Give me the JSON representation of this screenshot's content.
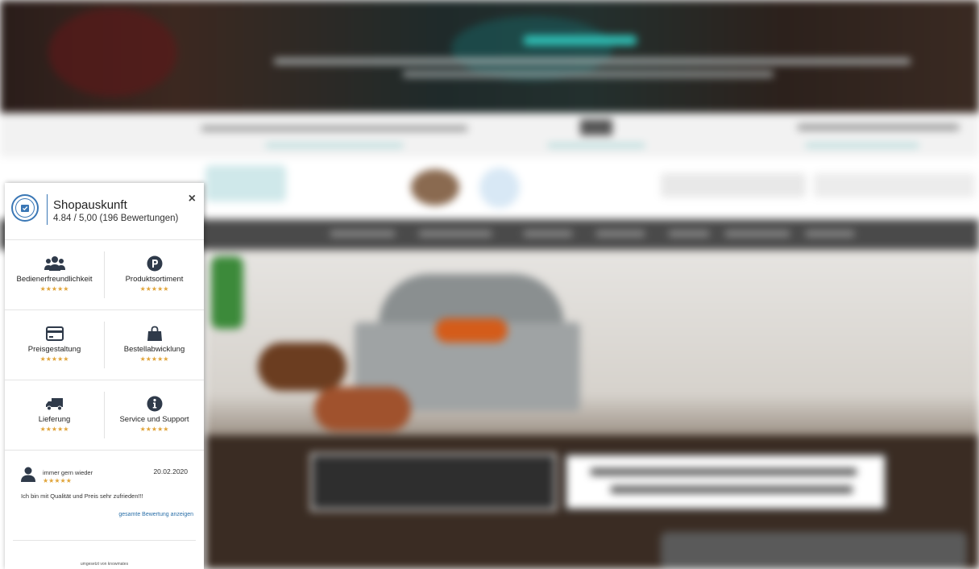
{
  "widget": {
    "title": "Shopauskunft",
    "rating": "4.84 / 5,00 (196 Bewertungen)",
    "close_icon": "×",
    "categories": [
      {
        "label": "Bedienerfreundlichkeit",
        "icon": "users-icon",
        "stars": "★★★★★"
      },
      {
        "label": "Produktsortiment",
        "icon": "parking-p-icon",
        "stars": "★★★★★"
      },
      {
        "label": "Preisgestaltung",
        "icon": "credit-card-icon",
        "stars": "★★★★★"
      },
      {
        "label": "Bestellabwicklung",
        "icon": "shopping-bag-icon",
        "stars": "★★★★★"
      },
      {
        "label": "Lieferung",
        "icon": "truck-icon",
        "stars": "★★★★★"
      },
      {
        "label": "Service und Support",
        "icon": "info-icon",
        "stars": "★★★★★"
      }
    ],
    "review": {
      "author": "immer gern wieder",
      "date": "20.02.2020",
      "stars": "★★★★★",
      "text": "Ich bin mit Qualität und Preis sehr zufrieden!!!",
      "link": "gesamte Bewertung anzeigen"
    },
    "footer": "umgesetzt von knowmates"
  },
  "colors": {
    "accent_blue": "#3a77b5",
    "star": "#e0a43a",
    "icon_dark": "#2f3a4a"
  }
}
